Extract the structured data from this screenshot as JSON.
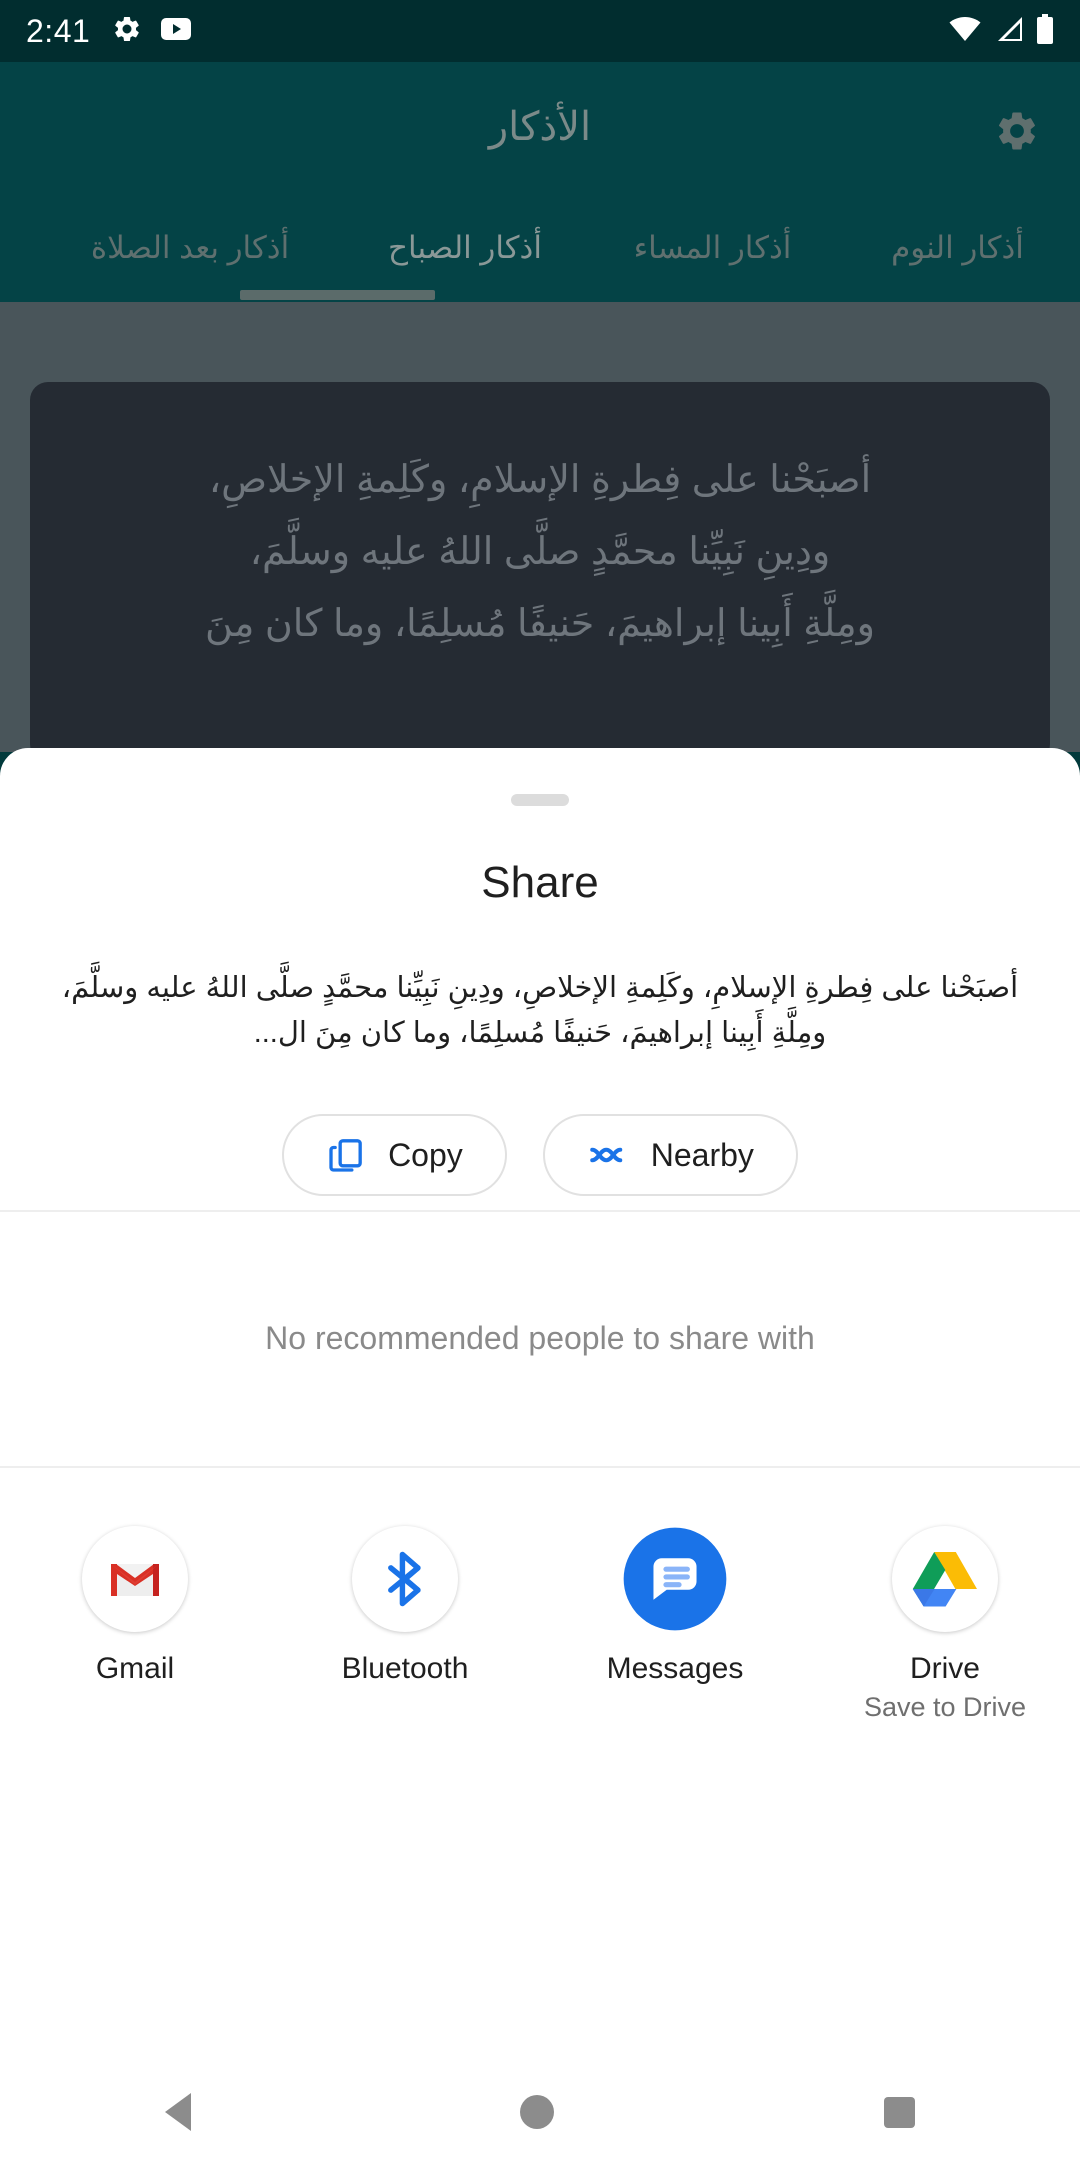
{
  "status_bar": {
    "time": "2:41",
    "left_icons": [
      "gear-icon",
      "youtube-icon"
    ],
    "right_icons": [
      "wifi-icon",
      "cellular-signal-icon",
      "battery-icon"
    ]
  },
  "background_app": {
    "title": "الأذكار",
    "settings_icon": "gear-icon",
    "tabs": [
      {
        "label": "أذكار النوم",
        "selected": false
      },
      {
        "label": "أذكار المساء",
        "selected": false
      },
      {
        "label": "أذكار الصباح",
        "selected": true
      },
      {
        "label": "أذكار بعد الصلاة",
        "selected": false
      }
    ],
    "card_lines": [
      "أصبَحْنا على فِطرةِ الإسلامِ، وكَلِمةِ الإخلاصِ،",
      "ودِينِ نَبِيِّنا محمَّدٍ صلَّى اللهُ عليه وسلَّمَ،",
      "ومِلَّةِ أَبِينا إبراهيمَ، حَنيفًا مُسلِمًا، وما كان مِنَ"
    ]
  },
  "share_sheet": {
    "title": "Share",
    "preview_text": "أصبَحْنا على فِطرةِ الإسلامِ، وكَلِمةِ الإخلاصِ، ودِينِ نَبِيِّنا محمَّدٍ صلَّى اللهُ عليه وسلَّمَ، ومِلَّةِ أَبِينا إبراهيمَ، حَنيفًا مُسلِمًا، وما كان مِنَ ال...",
    "actions": [
      {
        "label": "Copy",
        "icon": "copy-icon"
      },
      {
        "label": "Nearby",
        "icon": "nearby-share-icon"
      }
    ],
    "empty_state": "No recommended people to share with",
    "apps": [
      {
        "label": "Gmail",
        "sublabel": "",
        "icon": "gmail-icon"
      },
      {
        "label": "Bluetooth",
        "sublabel": "",
        "icon": "bluetooth-icon"
      },
      {
        "label": "Messages",
        "sublabel": "",
        "icon": "messages-icon"
      },
      {
        "label": "Drive",
        "sublabel": "Save to Drive",
        "icon": "google-drive-icon"
      }
    ]
  },
  "navigation_bar": {
    "back": "back-icon",
    "home": "home-icon",
    "recents": "recents-icon"
  },
  "colors": {
    "status_bar_bg": "#012d2f",
    "app_bar_bg": "#044346",
    "accent_blue": "#1a73e8",
    "sheet_bg": "#ffffff",
    "scrim": "#49555a"
  }
}
